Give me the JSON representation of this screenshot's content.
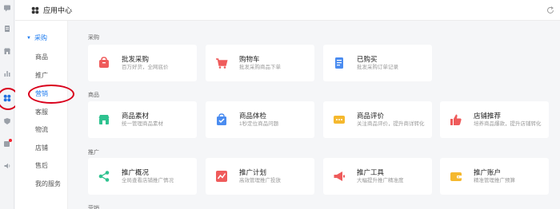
{
  "header": {
    "title": "应用中心"
  },
  "rail": {
    "icons": [
      "message-icon",
      "document-icon",
      "shop-icon",
      "bar-chart-icon",
      "apps-icon",
      "shield-icon",
      "notification-icon",
      "speaker-icon"
    ]
  },
  "subnav": {
    "group": "采购",
    "items": [
      "商品",
      "推广",
      "营销",
      "客服",
      "物流",
      "店铺",
      "售后",
      "我的服务"
    ],
    "active": "营销"
  },
  "sections": [
    {
      "title": "采购",
      "cards": [
        {
          "title": "批发采购",
          "desc": "百万好货，全网底价",
          "color": "#ef5b5b",
          "icon": "bag-icon"
        },
        {
          "title": "购物车",
          "desc": "批发采购商品下单",
          "color": "#ef5b5b",
          "icon": "cart-icon"
        },
        {
          "title": "已购买",
          "desc": "批发采购订单记录",
          "color": "#4a8cf0",
          "icon": "receipt-icon"
        }
      ]
    },
    {
      "title": "商品",
      "cards": [
        {
          "title": "商品素材",
          "desc": "统一管理商品素材",
          "color": "#2ec28f",
          "icon": "store-icon"
        },
        {
          "title": "商品体检",
          "desc": "1秒定位商品问题",
          "color": "#4a8cf0",
          "icon": "check-bag-icon"
        },
        {
          "title": "商品评价",
          "desc": "关注商品评价，提升商详转化",
          "color": "#f5b82e",
          "icon": "comment-icon"
        },
        {
          "title": "店铺推荐",
          "desc": "培养商品爆款，提升店铺转化",
          "color": "#ef5b5b",
          "icon": "thumb-up-icon"
        }
      ]
    },
    {
      "title": "推广",
      "cards": [
        {
          "title": "推广概况",
          "desc": "全局查看店铺推广情况",
          "color": "#2ec28f",
          "icon": "share-icon"
        },
        {
          "title": "推广计划",
          "desc": "高效管理推广投放",
          "color": "#ef5b5b",
          "icon": "trend-icon"
        },
        {
          "title": "推广工具",
          "desc": "大幅提升推广精准度",
          "color": "#ef5b5b",
          "icon": "megaphone-icon"
        },
        {
          "title": "推广账户",
          "desc": "精准管理推广预算",
          "color": "#f5b82e",
          "icon": "wallet-icon"
        }
      ]
    }
  ],
  "footer_section": {
    "title": "营销"
  }
}
